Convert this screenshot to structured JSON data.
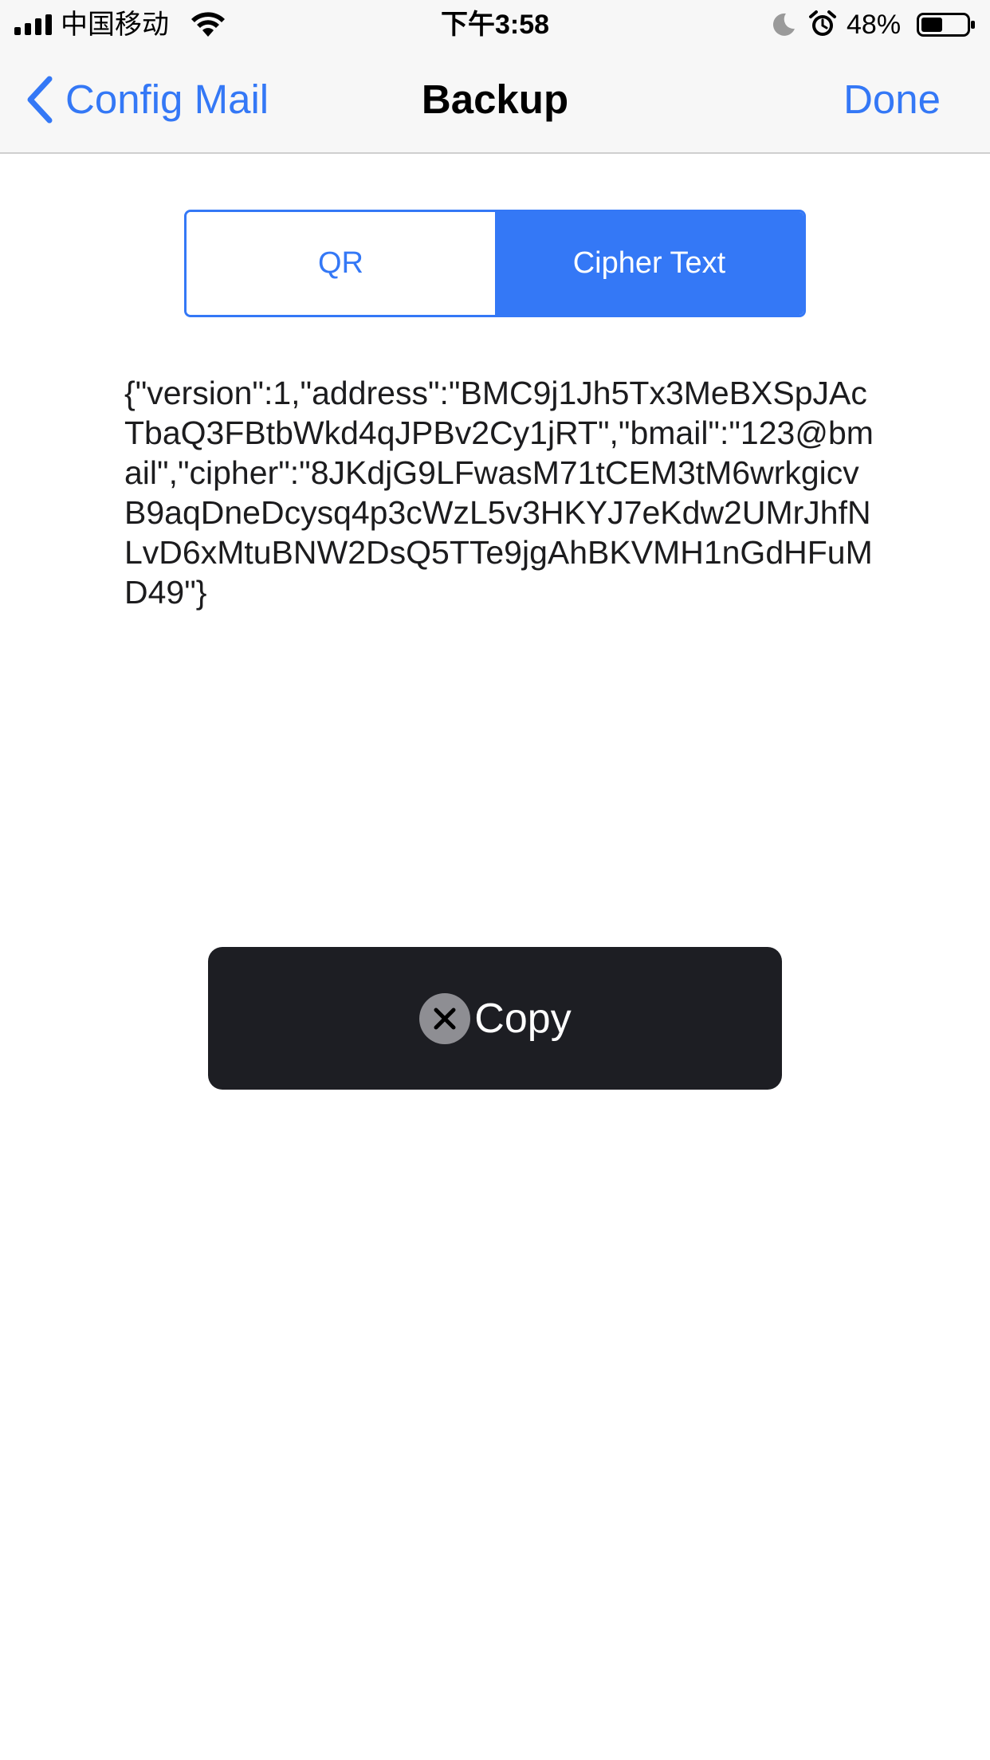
{
  "status_bar": {
    "carrier": "中国移动",
    "time": "下午3:58",
    "battery_percent": "48%",
    "battery_level": 0.48,
    "icons": [
      "signal-icon",
      "wifi-icon",
      "moon-icon",
      "alarm-icon",
      "battery-icon"
    ]
  },
  "nav": {
    "back_label": "Config Mail",
    "title": "Backup",
    "done_label": "Done",
    "back_icon": "chevron-left-icon"
  },
  "segmented": {
    "options": [
      "QR",
      "Cipher Text"
    ],
    "selected": "Cipher Text"
  },
  "content": {
    "cipher_text": "{\"version\":1,\"address\":\"BMC9j1Jh5Tx3MeBXSpJAcTbaQ3FBtbWkd4qJPBv2Cy1jRT\",\"bmail\":\"123@bmail\",\"cipher\":\"8JKdjG9LFwasM71tCEM3tM6wrkgicvB9aqDneDcysq4p3cWzL5v3HKYJ7eKdw2UMrJhfNLvD6xMtuBNW2DsQ5TTe9jgAhBKVMH1nGdHFuMD49\"}"
  },
  "toast": {
    "label": "Copy",
    "icon": "close-icon"
  },
  "colors": {
    "accent": "#3478f6",
    "toast_background": "#1d1e23",
    "nav_background": "#f7f7f7"
  }
}
